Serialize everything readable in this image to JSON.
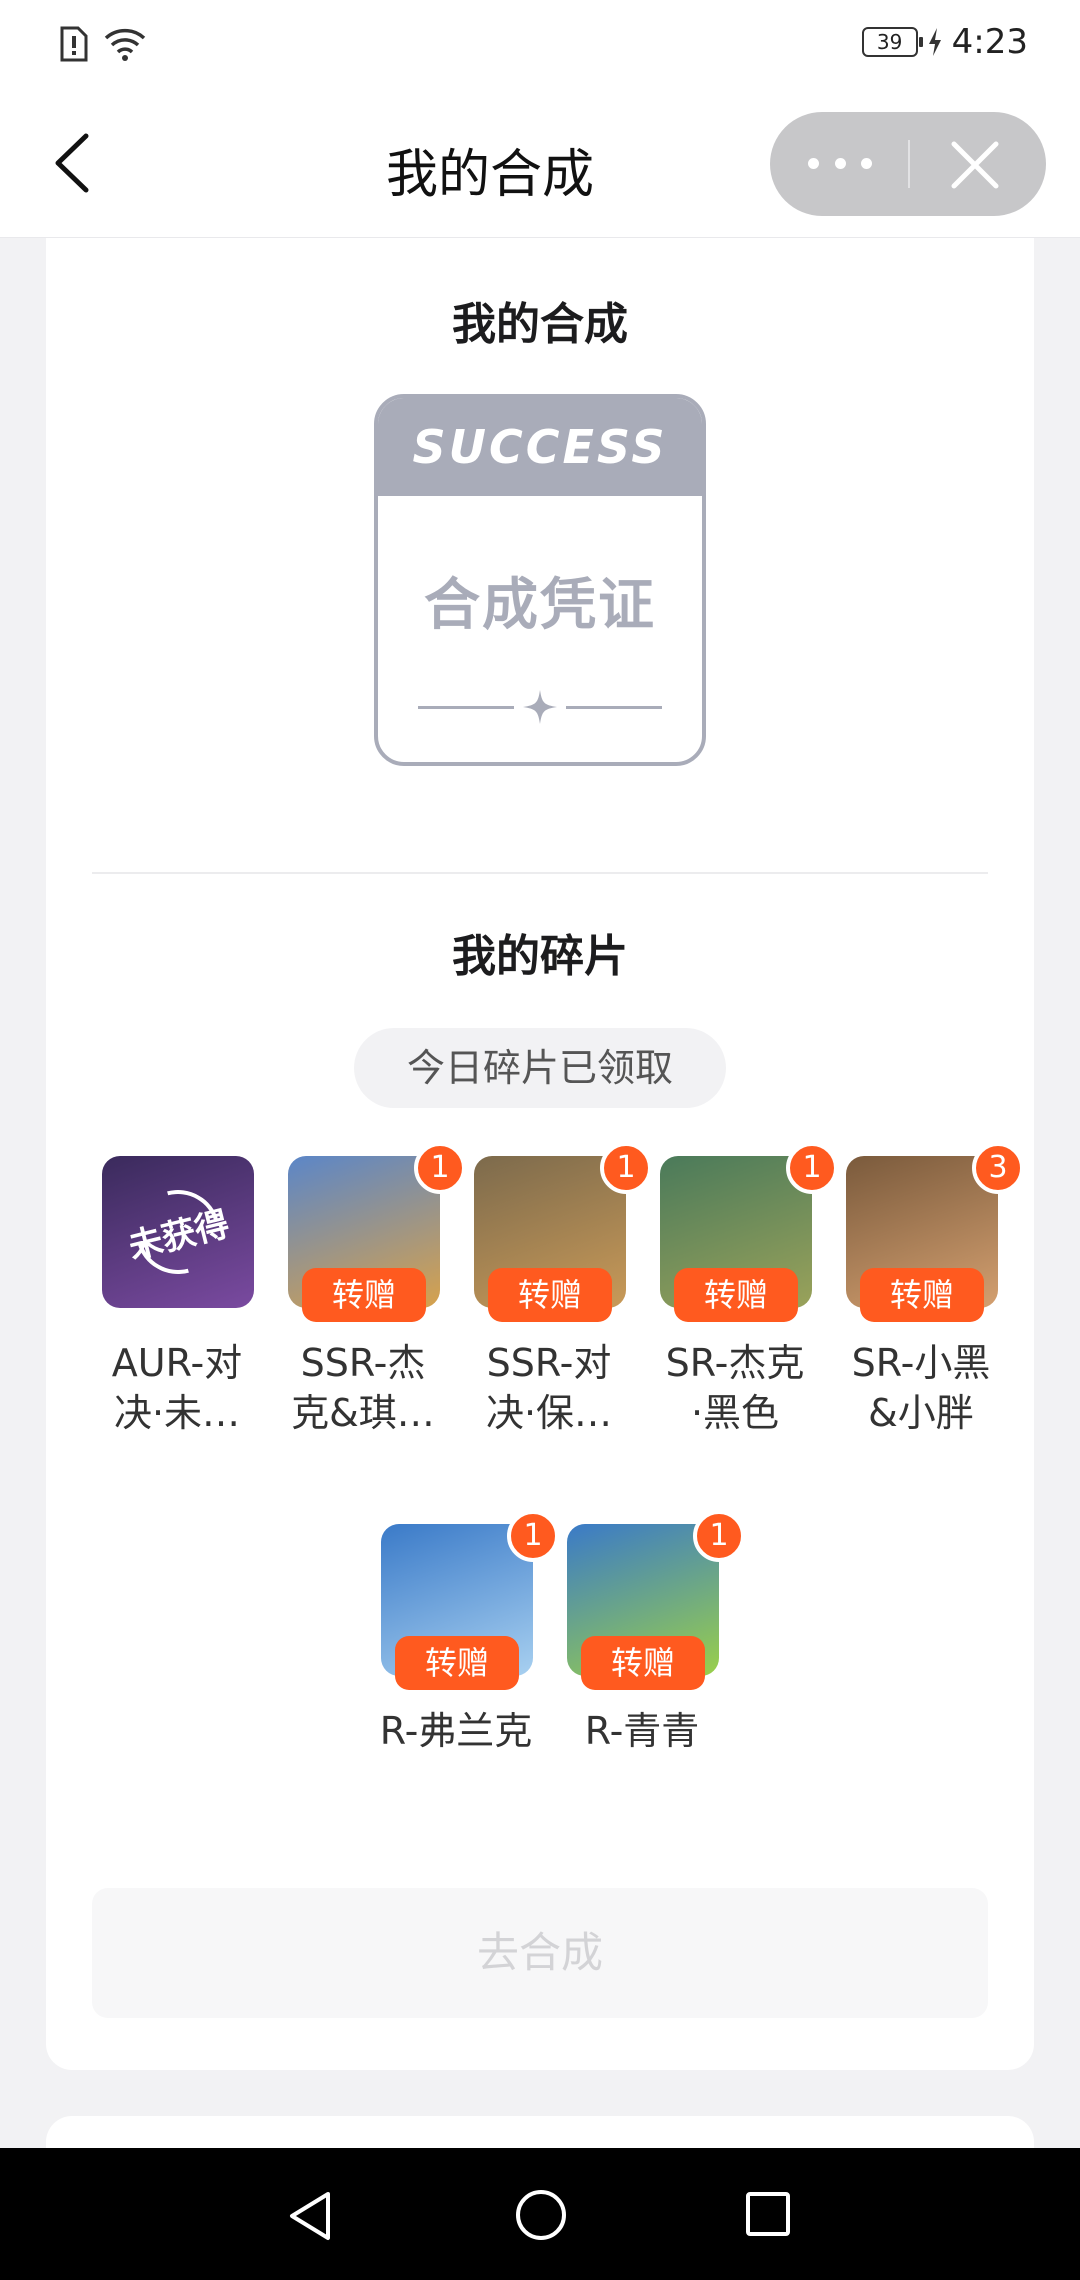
{
  "status": {
    "battery": "39",
    "time": "4:23"
  },
  "header": {
    "title": "我的合成"
  },
  "synth": {
    "title": "我的合成",
    "voucher_head": "SUCCESS",
    "voucher_body": "合成凭证"
  },
  "fragments": {
    "title": "我的碎片",
    "daily_status": "今日碎片已领取",
    "gift_label": "转赠",
    "locked_label": "未获得",
    "items": [
      {
        "name": "AUR-对决·未…",
        "count": null,
        "owned": false,
        "colors": [
          "#3a2a5c",
          "#7a4aa0"
        ]
      },
      {
        "name": "SSR-杰克&琪…",
        "count": "1",
        "owned": true,
        "colors": [
          "#5b86c8",
          "#d7a24c"
        ]
      },
      {
        "name": "SSR-对决·保…",
        "count": "1",
        "owned": true,
        "colors": [
          "#7c6a4c",
          "#c99a58"
        ]
      },
      {
        "name": "SR-杰克·黑色",
        "count": "1",
        "owned": true,
        "colors": [
          "#4a7a5a",
          "#9aa25a"
        ]
      },
      {
        "name": "SR-小黑&小胖",
        "count": "3",
        "owned": true,
        "colors": [
          "#7a5a3c",
          "#d4a070"
        ]
      },
      {
        "name": "R-弗兰克",
        "count": "1",
        "owned": true,
        "colors": [
          "#3a7ac8",
          "#a8d0f0"
        ]
      },
      {
        "name": "R-青青",
        "count": "1",
        "owned": true,
        "colors": [
          "#3a7ac8",
          "#9ad04a"
        ]
      }
    ]
  },
  "action": {
    "label": "去合成"
  }
}
